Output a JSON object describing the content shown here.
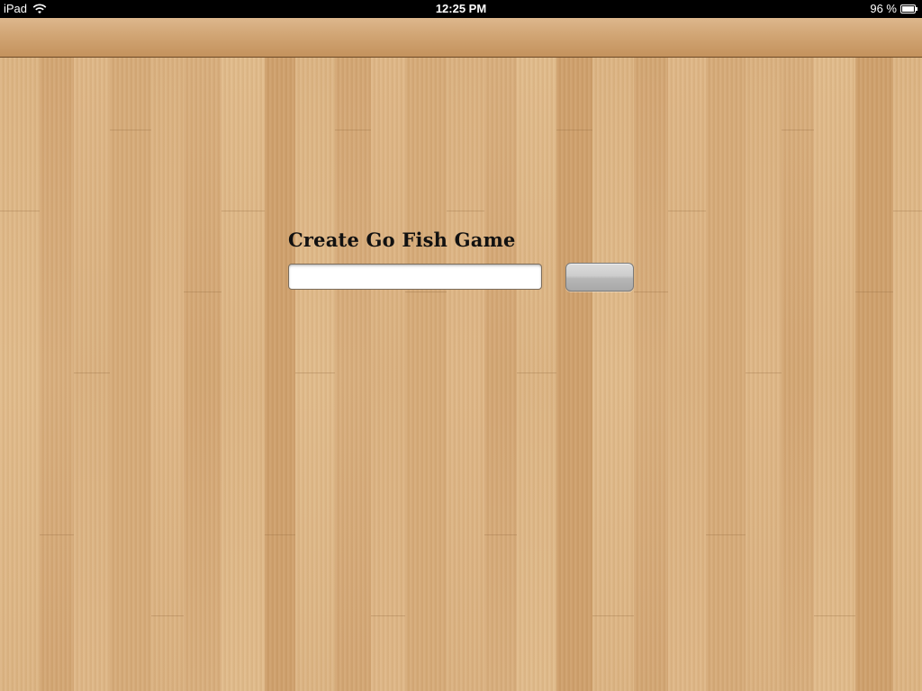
{
  "status_bar": {
    "device": "iPad",
    "time": "12:25 PM",
    "battery": "96 %",
    "wifi_icon": "wifi-icon",
    "battery_icon": "battery-icon"
  },
  "nav_bar": {
    "title": ""
  },
  "form": {
    "title": "Create Go Fish Game",
    "input_value": "",
    "input_placeholder": "",
    "button_label": ""
  },
  "colors": {
    "wood_base": "#d9b07e",
    "nav_bar": "#d1a574",
    "title_text": "#111111"
  }
}
